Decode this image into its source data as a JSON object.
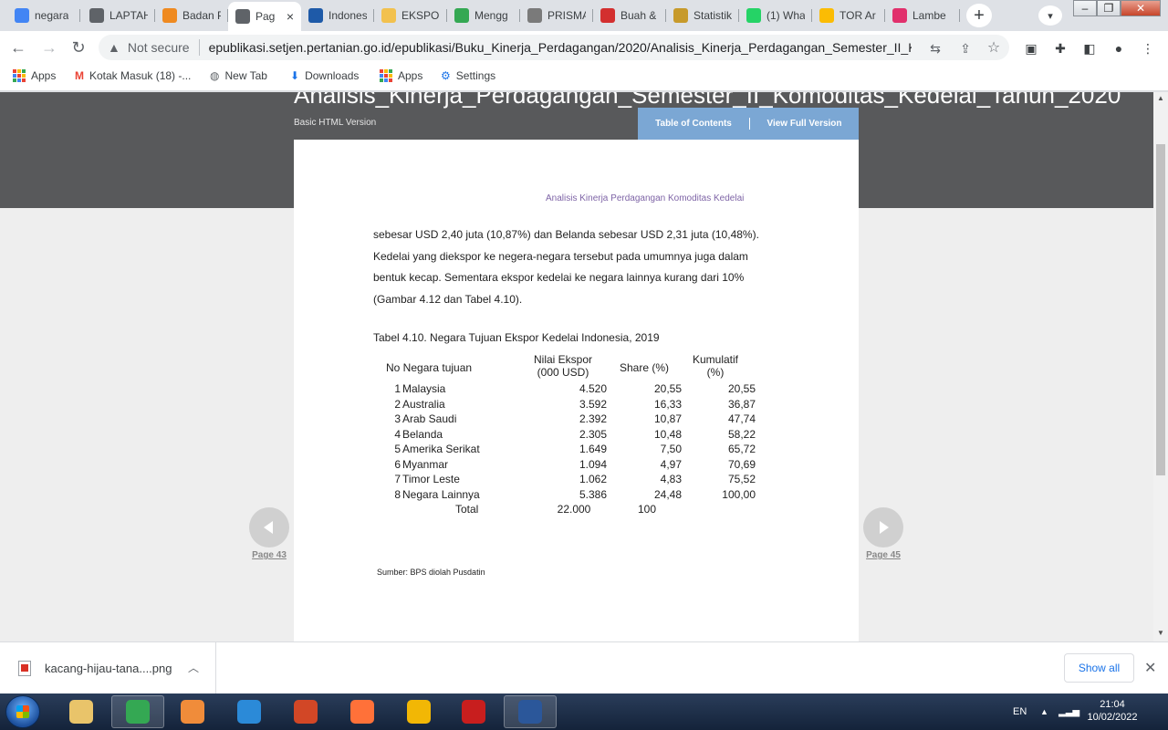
{
  "browser": {
    "tabs": [
      {
        "title": "negara",
        "icon": "google-icon",
        "color": "#4285f4"
      },
      {
        "title": "LAPTAH",
        "icon": "globe-icon",
        "color": "#5f6368"
      },
      {
        "title": "Badan P",
        "icon": "bps-icon",
        "color": "#ef8a20"
      },
      {
        "title": "Pag",
        "icon": "globe-icon",
        "color": "#5f6368",
        "active": true
      },
      {
        "title": "Indones",
        "icon": "emblem-icon",
        "color": "#1e5aa8"
      },
      {
        "title": "EKSPOR",
        "icon": "dok-icon",
        "color": "#f2c14e"
      },
      {
        "title": "Mengg",
        "icon": "app-icon",
        "color": "#34a853"
      },
      {
        "title": "PRISMA",
        "icon": "prisma-icon",
        "color": "#7a7a7a"
      },
      {
        "title": "Buah &",
        "icon": "pulse-icon",
        "color": "#d32f2f"
      },
      {
        "title": "Statistik",
        "icon": "garuda-icon",
        "color": "#c79a2b"
      },
      {
        "title": "(1) Wha",
        "icon": "whatsapp-icon",
        "color": "#25d366"
      },
      {
        "title": "TOR Ar",
        "icon": "drive-icon",
        "color": "#fbbc04"
      },
      {
        "title": "Lambe",
        "icon": "instagram-icon",
        "color": "#e1306c"
      }
    ],
    "new_tab": "+",
    "active_tab_close": "×",
    "address": {
      "security": "Not secure",
      "url": "epublikasi.setjen.pertanian.go.id/epublikasi/Buku_Kinerja_Perdagangan/2020/Analisis_Kinerja_Perdagangan_Semester_II_Kom..."
    },
    "bookmarks": [
      {
        "label": "Apps",
        "icon": "apps-grid-icon"
      },
      {
        "label": "Kotak Masuk (18) -...",
        "icon": "gmail-icon"
      },
      {
        "label": "New Tab",
        "icon": "globe-icon"
      },
      {
        "label": "Downloads",
        "icon": "download-icon"
      },
      {
        "label": "Apps",
        "icon": "apps-grid-icon"
      },
      {
        "label": "Settings",
        "icon": "gear-icon"
      }
    ]
  },
  "viewer": {
    "doc_title": "Analisis_Kinerja_Perdagangan_Semester_II_Komoditas_Kedelai_Tahun_2020",
    "basic_version": "Basic HTML Version",
    "toc_label": "Table of Contents",
    "full_version_label": "View Full Version",
    "prev_page": "Page 43",
    "next_page": "Page 45"
  },
  "document": {
    "running_head": "Analisis Kinerja Perdagangan Komoditas Kedelai",
    "paragraph_lines": [
      "sebesar USD 2,40 juta (10,87%) dan Belanda sebesar USD 2,31 juta (10,48%).",
      "Kedelai yang diekspor ke negera-negara tersebut pada umumnya juga dalam",
      "bentuk kecap. Sementara ekspor kedelai ke negara lainnya kurang dari 10%",
      "(Gambar 4.12 dan Tabel 4.10)."
    ],
    "table_caption": "Tabel 4.10. Negara Tujuan Ekspor Kedelai Indonesia, 2019",
    "table": {
      "headers": {
        "no_country": "No Negara tujuan",
        "value_line1": "Nilai Ekspor",
        "value_line2": "(000 USD)",
        "share": "Share (%)",
        "cumulative_line1": "Kumulatif",
        "cumulative_line2": "(%)"
      },
      "rows": [
        {
          "no": "1",
          "country": "Malaysia",
          "value": "4.520",
          "share": "20,55",
          "cumulative": "20,55"
        },
        {
          "no": "2",
          "country": "Australia",
          "value": "3.592",
          "share": "16,33",
          "cumulative": "36,87"
        },
        {
          "no": "3",
          "country": "Arab Saudi",
          "value": "2.392",
          "share": "10,87",
          "cumulative": "47,74"
        },
        {
          "no": "4",
          "country": "Belanda",
          "value": "2.305",
          "share": "10,48",
          "cumulative": "58,22"
        },
        {
          "no": "5",
          "country": "Amerika Serikat",
          "value": "1.649",
          "share": "7,50",
          "cumulative": "65,72"
        },
        {
          "no": "6",
          "country": "Myanmar",
          "value": "1.094",
          "share": "4,97",
          "cumulative": "70,69"
        },
        {
          "no": "7",
          "country": "Timor Leste",
          "value": "1.062",
          "share": "4,83",
          "cumulative": "75,52"
        },
        {
          "no": "8",
          "country": "Negara Lainnya",
          "value": "5.386",
          "share": "24,48",
          "cumulative": "100,00"
        }
      ],
      "total": {
        "label": "Total",
        "value": "22.000",
        "share": "100"
      }
    },
    "source": "Sumber: BPS diolah Pusdatin"
  },
  "downloads": {
    "file": "kacang-hijau-tana....png",
    "show_all": "Show all"
  },
  "taskbar": {
    "apps": [
      {
        "name": "file-explorer",
        "color": "#e9c46a"
      },
      {
        "name": "chrome",
        "color": "#34a853",
        "open": true
      },
      {
        "name": "media-player",
        "color": "#f08c3a"
      },
      {
        "name": "internet-explorer",
        "color": "#2b8ad8"
      },
      {
        "name": "powerpoint",
        "color": "#d24726"
      },
      {
        "name": "firefox",
        "color": "#ff7139"
      },
      {
        "name": "triangle-app",
        "color": "#f2b705"
      },
      {
        "name": "acrobat",
        "color": "#c81e1e"
      },
      {
        "name": "word",
        "color": "#2b579a",
        "open": true
      }
    ],
    "language": "EN",
    "time": "21:04",
    "date": "10/02/2022"
  }
}
